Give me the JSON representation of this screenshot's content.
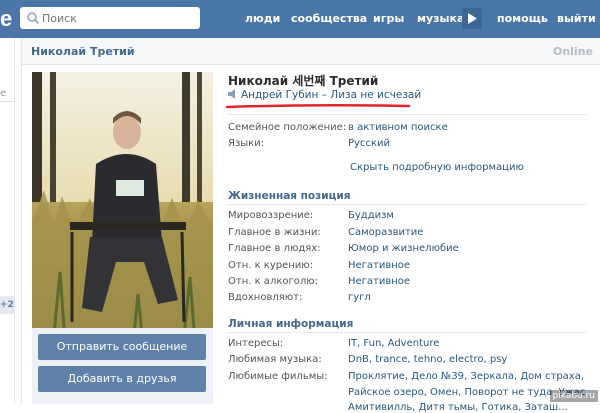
{
  "header": {
    "logo_text": "e",
    "search_placeholder": "Поиск",
    "nav": [
      "люди",
      "сообщества",
      "игры",
      "музыка",
      "помощь",
      "выйти"
    ]
  },
  "rail": {
    "badge": "+2",
    "dash": "е"
  },
  "profile": {
    "header_name": "Николай Третий",
    "online": "Online",
    "full_name": "Николай 세번째 Третий",
    "status": "Андрей Губин – Лиза не исчезай",
    "info": [
      {
        "label": "Семейное положение:",
        "value": "в активном поиске"
      },
      {
        "label": "Языки:",
        "value": "Русский"
      }
    ],
    "hide_link": "Скрыть подробную информацию",
    "life_title": "Жизненная позиция",
    "life": [
      {
        "label": "Мировоззрение:",
        "value": "Буддизм"
      },
      {
        "label": "Главное в жизни:",
        "value": "Саморазвитие"
      },
      {
        "label": "Главное в людях:",
        "value": "Юмор и жизнелюбие"
      },
      {
        "label": "Отн. к курению:",
        "value": "Негативное"
      },
      {
        "label": "Отн. к алкоголю:",
        "value": "Негативное"
      },
      {
        "label": "Вдохновляют:",
        "value": "гугл"
      }
    ],
    "personal_title": "Личная информация",
    "personal": [
      {
        "label": "Интересы:",
        "value": "IT, Fun, Adventure"
      },
      {
        "label": "Любимая музыка:",
        "value": "DnB, trance, tehno, electro, psy"
      },
      {
        "label": "Любимые фильмы:",
        "value": "Проклятие, Дело №39, Зеркала, Дом страха,"
      }
    ],
    "films_line2": "Райское озеро, Омен, Поворот не туда, Ужас",
    "films_line3": "Амитивилль, Дитя тьмы, Готика, Заташ...",
    "buttons": {
      "message": "Отправить сообщение",
      "add": "Добавить в друзья"
    }
  },
  "watermark": "pikabu.ru",
  "colors": {
    "topbar": "#4a76a8",
    "link": "#2b587a",
    "section": "#45688e",
    "button": "#5e81a8",
    "underline": "#e0242b"
  }
}
